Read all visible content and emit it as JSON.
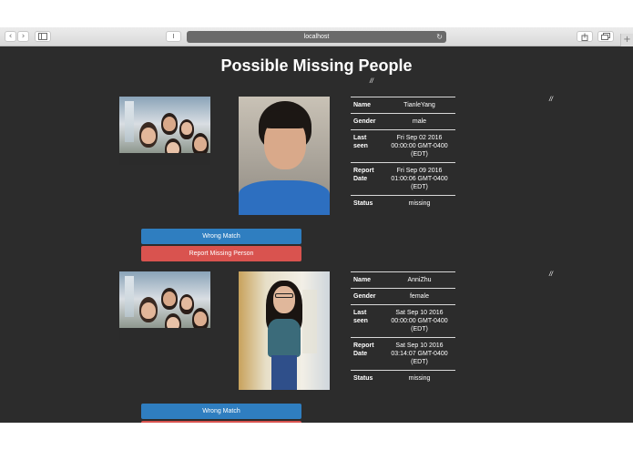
{
  "browser": {
    "url": "localhost"
  },
  "page": {
    "title": "Possible Missing People",
    "slashes": "//"
  },
  "labels": {
    "name": "Name",
    "gender": "Gender",
    "last_seen": "Last seen",
    "report_date": "Report Date",
    "status": "Status",
    "wrong_match": "Wrong Match",
    "report_missing": "Report Missing Person"
  },
  "matches": [
    {
      "name": "TianleYang",
      "gender": "male",
      "last_seen": "Fri Sep 02 2016 00:00:00 GMT-0400 (EDT)",
      "report_date": "Fri Sep 09 2016 01:00:06 GMT-0400 (EDT)",
      "status": "missing"
    },
    {
      "name": "AnniZhu",
      "gender": "female",
      "last_seen": "Sat Sep 10 2016 00:00:00 GMT-0400 (EDT)",
      "report_date": "Sat Sep 10 2016 03:14:07 GMT-0400 (EDT)",
      "status": "missing"
    }
  ]
}
